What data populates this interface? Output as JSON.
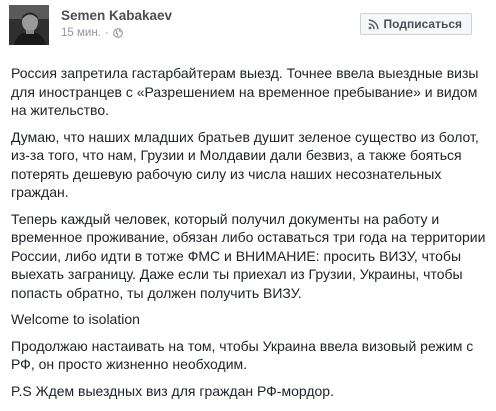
{
  "post": {
    "author": "Semen Kabakaev",
    "time": "15 мин.",
    "separator": "·",
    "subscribe_label": "Подписаться",
    "paragraphs": [
      "Россия запретила гастарбайтерам выезд. Точнее ввела выездные визы для иностранцев с «Разрешением на временное пребывание» и видом на жительство.",
      "Думаю, что наших младших братьев душит зеленое существо из болот, из-за того, что нам, Грузии и Молдавии дали безвиз, а также бояться потерять дешевую рабочую силу из числа наших несознательных граждан.",
      "Теперь каждый человек, который получил документы на работу и временное проживание, обязан либо оставаться три года на территории России, либо идти в тотже ФМС и ВНИМАНИЕ: просить ВИЗУ, чтобы выехать заграницу. Даже если ты приехал из Грузии, Украины, чтобы попасть обратно, ты должен получить ВИЗУ.",
      "Welcome to isolation",
      "Продолжаю настаивать на том, чтобы Украина ввела визовый режим с РФ, он просто жизненно необходим.",
      "P.S Ждем выездных виз для граждан РФ-мордор."
    ]
  },
  "icons": {
    "avatar": "avatar-photo",
    "audience": "globe-icon",
    "subscribe": "rss-icon"
  },
  "colors": {
    "text": "#1d2129",
    "meta": "#90949c",
    "name": "#4b4f56",
    "button_bg": "#f6f7f9",
    "button_border": "#ced0d4"
  }
}
